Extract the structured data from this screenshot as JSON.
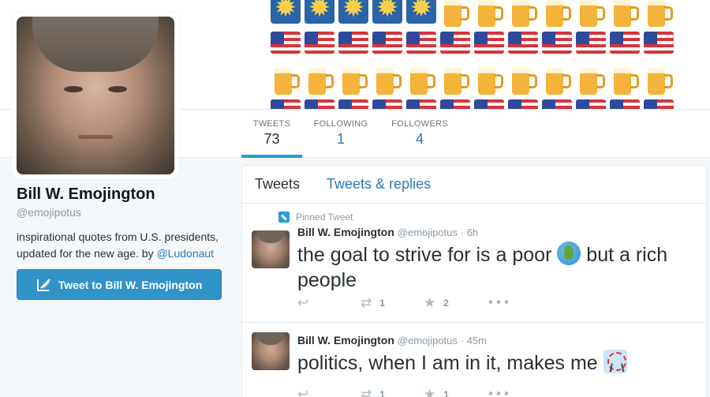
{
  "banner": {
    "rows": [
      [
        "sun",
        "sun",
        "sun",
        "sun",
        "sun",
        "beer",
        "beer",
        "beer",
        "beer",
        "beer",
        "beer",
        "beer"
      ],
      [
        "flag",
        "flag",
        "flag",
        "flag",
        "flag",
        "flag",
        "flag",
        "flag",
        "flag",
        "flag",
        "flag",
        "flag"
      ],
      [
        "beer",
        "beer",
        "beer",
        "beer",
        "beer",
        "beer",
        "beer",
        "beer",
        "beer",
        "beer",
        "beer",
        "beer"
      ],
      [
        "flag",
        "flag",
        "flag",
        "flag",
        "flag",
        "flag",
        "flag",
        "flag",
        "flag",
        "flag",
        "flag",
        "flag"
      ]
    ]
  },
  "nav": {
    "tweets_label": "TWEETS",
    "tweets_value": "73",
    "following_label": "FOLLOWING",
    "following_value": "1",
    "followers_label": "FOLLOWERS",
    "followers_value": "4"
  },
  "profile": {
    "name": "Bill W. Emojington",
    "handle": "@emojipotus",
    "bio": "inspirational quotes from U.S. presidents, updated for the new age. by ",
    "bio_link": "@Ludonaut",
    "tweet_to_label": "Tweet to Bill W. Emojington"
  },
  "timeline": {
    "tab_tweets": "Tweets",
    "tab_replies": "Tweets & replies",
    "pinned_label": "Pinned Tweet",
    "tweets": [
      {
        "name": "Bill W. Emojington",
        "handle": "@emojipotus",
        "time": "· 6h",
        "text_before": "the goal to strive for is a poor ",
        "emoji": "globe-icon",
        "text_after": " but a rich people",
        "retweets": "1",
        "favorites": "2"
      },
      {
        "name": "Bill W. Emojington",
        "handle": "@emojipotus",
        "time": "· 45m",
        "text_before": "politics, when I am in it, makes me ",
        "emoji": "ferris-wheel-icon",
        "text_after": "",
        "retweets": "1",
        "favorites": "1"
      }
    ]
  },
  "colors": {
    "accent": "#2b7bb9",
    "button": "#3293c9",
    "background": "#f5f8fa"
  }
}
